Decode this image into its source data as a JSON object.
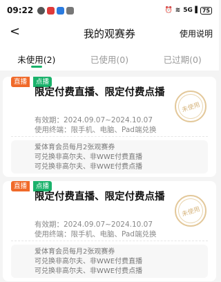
{
  "status_bar": {
    "time": "09:22",
    "signal": "5G",
    "battery": "75"
  },
  "header": {
    "back_icon": "chevron-left-icon",
    "title": "我的观赛券",
    "help_label": "使用说明"
  },
  "tabs": [
    {
      "label": "未使用(2)",
      "active": true
    },
    {
      "label": "已使用(0)",
      "active": false
    },
    {
      "label": "已过期(0)",
      "active": false
    }
  ],
  "colors": {
    "accent_green": "#1ab26b",
    "live_orange": "#f06a2a"
  },
  "coupons": [
    {
      "badge_live": "直播",
      "badge_vod": "点播",
      "name": "限定付费直播、限定付费点播",
      "validity": "有效期：2024.09.07~2024.10.07",
      "terminal": "使用终端：限手机、电脑、Pad端兑换",
      "stamp": "未使用",
      "desc": [
        "爱体育会员每月2张观赛券",
        "可兑换非高尔夫、非WWE付费直播",
        "可兑换非高尔夫、非WWE付费点播"
      ]
    },
    {
      "badge_live": "直播",
      "badge_vod": "点播",
      "name": "限定付费直播、限定付费点播",
      "validity": "有效期：2024.09.07~2024.10.07",
      "terminal": "使用终端：限手机、电脑、Pad端兑换",
      "stamp": "未使用",
      "desc": [
        "爱体育会员每月2张观赛券",
        "可兑换非高尔夫、非WWE付费直播",
        "可兑换非高尔夫、非WWE付费点播"
      ]
    }
  ]
}
